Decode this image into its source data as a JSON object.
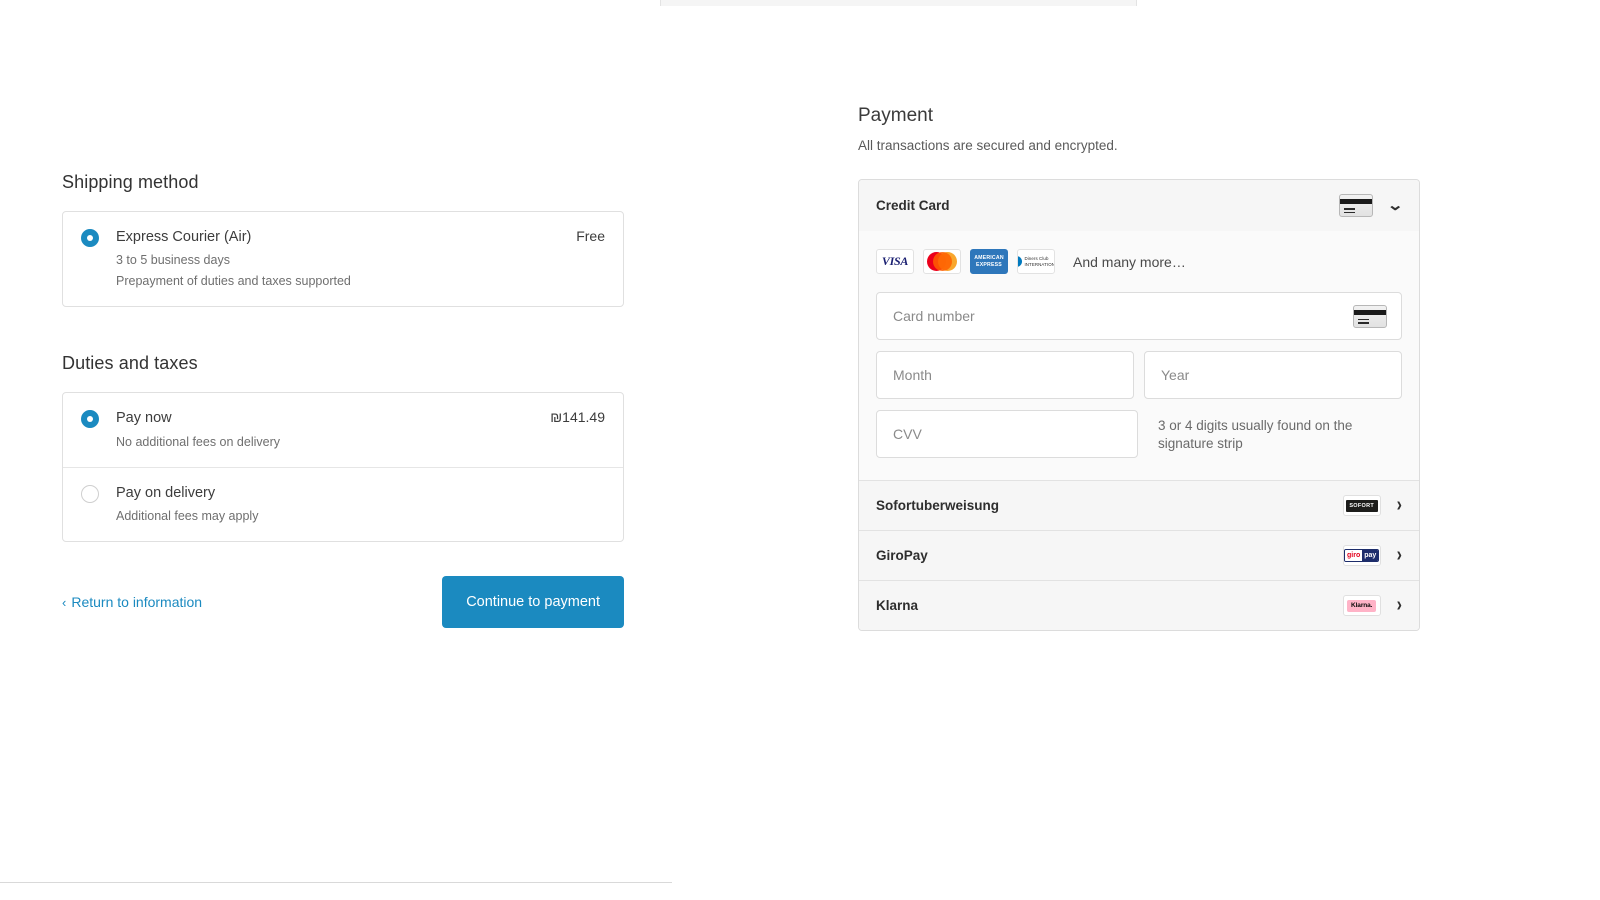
{
  "shipping": {
    "title": "Shipping method",
    "options": [
      {
        "name": "Express Courier (Air)",
        "sub1": "3 to 5 business days",
        "sub2": "Prepayment of duties and taxes supported",
        "price": "Free",
        "selected": true
      }
    ]
  },
  "duties": {
    "title": "Duties and taxes",
    "options": [
      {
        "name": "Pay now",
        "sub": "No additional fees on delivery",
        "price": "₪141.49",
        "selected": true
      },
      {
        "name": "Pay on delivery",
        "sub": "Additional fees may apply",
        "price": "",
        "selected": false
      }
    ]
  },
  "actions": {
    "return_link": "Return to information",
    "return_chevron": "‹",
    "continue_button": "Continue to payment"
  },
  "payment": {
    "title": "Payment",
    "subtitle": "All transactions are secured and encrypted.",
    "credit_card": {
      "label": "Credit Card",
      "expanded": true,
      "chevron": "⌄",
      "brands": [
        {
          "id": "visa-logo",
          "text": "VISA"
        },
        {
          "id": "mastercard-logo",
          "text": ""
        },
        {
          "id": "amex-logo",
          "text": "AMERICAN EXPRESS"
        },
        {
          "id": "diners-club-logo",
          "text": "Diners Club INTERNATIONAL"
        }
      ],
      "more_text": "And many more…",
      "fields": {
        "card_number": {
          "placeholder": "Card number",
          "value": ""
        },
        "month": {
          "placeholder": "Month",
          "value": ""
        },
        "year": {
          "placeholder": "Year",
          "value": ""
        },
        "cvv": {
          "placeholder": "CVV",
          "value": ""
        }
      },
      "cvv_hint": "3 or 4 digits usually found on the signature strip"
    },
    "other_methods": [
      {
        "label": "Sofortuberweisung",
        "logo_text": "SOFORT",
        "chevron": "›"
      },
      {
        "label": "GiroPay",
        "logo_text": "giropay",
        "chevron": "›"
      },
      {
        "label": "Klarna",
        "logo_text": "Klarna.",
        "chevron": "›"
      }
    ]
  },
  "colors": {
    "accent": "#1b8ac0",
    "text": "#333333",
    "muted": "#6f6f6f",
    "panel": "#f6f6f6",
    "border": "#dcdcdc"
  }
}
